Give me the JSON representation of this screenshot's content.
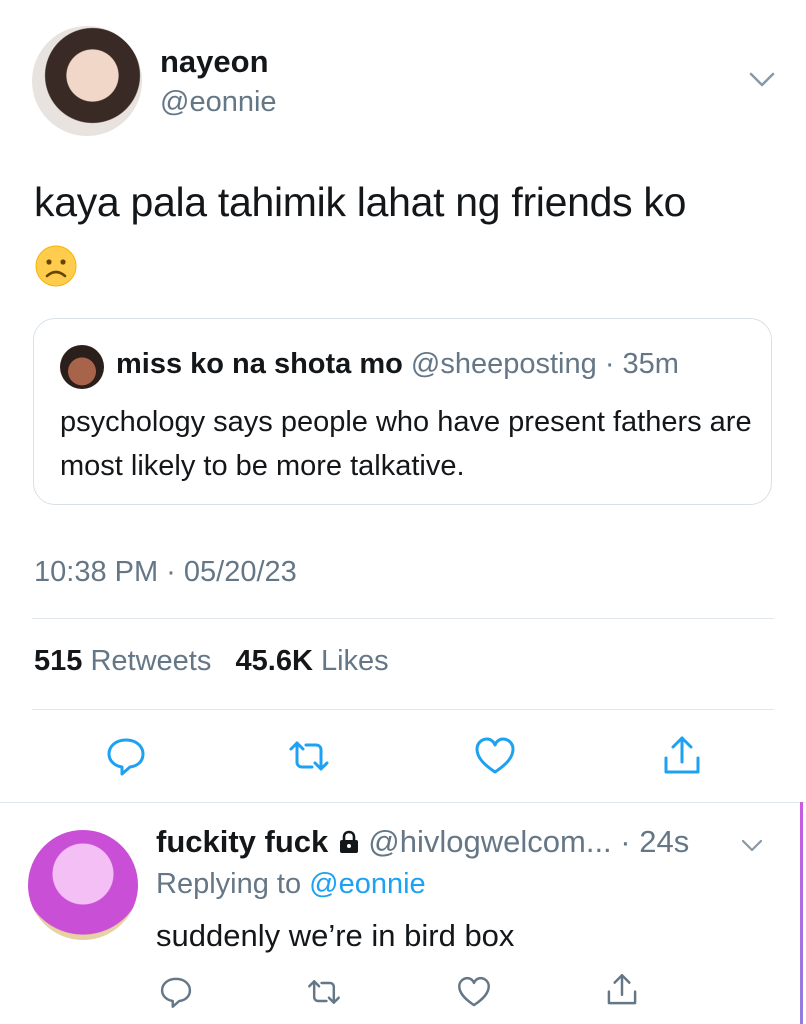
{
  "tweet": {
    "display_name": "nayeon",
    "handle": "@eonnie",
    "text": "kaya pala tahimik lahat ng friends ko",
    "emoji": "frowning-face",
    "timestamp": "10:38 PM · 05/20/23",
    "retweets_count": "515",
    "retweets_label": "Retweets",
    "likes_count": "45.6K",
    "likes_label": "Likes"
  },
  "quote": {
    "display_name": "miss ko na shota mo",
    "handle": "@sheeposting",
    "time": "· 35m",
    "text": "psychology says people who have present fathers are most likely to be more talkative."
  },
  "reply": {
    "display_name": "fuckity fuck",
    "handle": "@hivlogwelcom...",
    "time": "· 24s",
    "replying_prefix": "Replying to",
    "replying_to": "@eonnie",
    "text": "suddenly we’re in bird box"
  },
  "icons": {
    "action_color": "#1da1f2",
    "chevron_color": "#8899a6"
  }
}
